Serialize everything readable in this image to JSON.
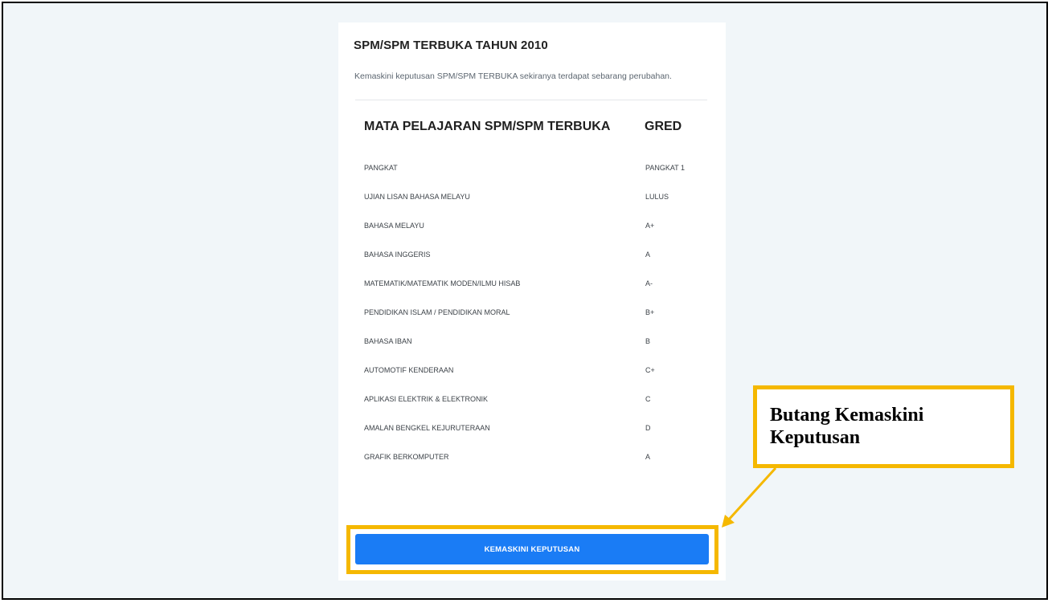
{
  "card": {
    "title": "SPM/SPM TERBUKA TAHUN 2010",
    "subtitle": "Kemaskini keputusan SPM/SPM TERBUKA sekiranya terdapat sebarang perubahan.",
    "table": {
      "headers": {
        "subject": "MATA PELAJARAN SPM/SPM TERBUKA",
        "grade": "GRED"
      },
      "rows": [
        {
          "subject": "PANGKAT",
          "grade": "PANGKAT 1"
        },
        {
          "subject": "UJIAN LISAN BAHASA MELAYU",
          "grade": "LULUS"
        },
        {
          "subject": "BAHASA MELAYU",
          "grade": "A+"
        },
        {
          "subject": "BAHASA INGGERIS",
          "grade": "A"
        },
        {
          "subject": "MATEMATIK/MATEMATIK MODEN/ILMU HISAB",
          "grade": "A-"
        },
        {
          "subject": "PENDIDIKAN ISLAM / PENDIDIKAN MORAL",
          "grade": "B+"
        },
        {
          "subject": "BAHASA IBAN",
          "grade": "B"
        },
        {
          "subject": "AUTOMOTIF KENDERAAN",
          "grade": "C+"
        },
        {
          "subject": "APLIKASI ELEKTRIK & ELEKTRONIK",
          "grade": "C"
        },
        {
          "subject": "AMALAN BENGKEL KEJURUTERAAN",
          "grade": "D"
        },
        {
          "subject": "GRAFIK BERKOMPUTER",
          "grade": "A"
        }
      ]
    },
    "update_button_label": "KEMASKINI KEPUTUSAN"
  },
  "annotation": {
    "line1": "Butang Kemaskini",
    "line2": "Keputusan"
  },
  "colors": {
    "background": "#f1f6f9",
    "button": "#1a7cf5",
    "highlight": "#f5b800"
  }
}
